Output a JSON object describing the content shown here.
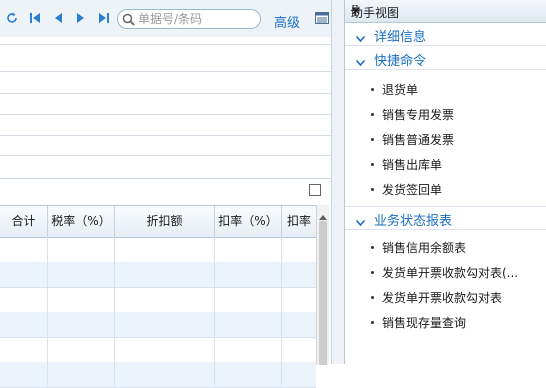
{
  "toolbar": {
    "search_placeholder": "单据号/条码",
    "advanced_label": "高级"
  },
  "grid": {
    "columns": [
      "合计",
      "税率（%）",
      "折扣额",
      "扣率（%）",
      "扣率"
    ],
    "row_count": 6
  },
  "assistant_panel": {
    "title": "助手视图",
    "sections": [
      {
        "label": "详细信息",
        "items": []
      },
      {
        "label": "快捷命令",
        "items": [
          "退货单",
          "销售专用发票",
          "销售普通发票",
          "销售出库单",
          "发货签回单"
        ]
      },
      {
        "label": "业务状态报表",
        "items": [
          "销售信用余额表",
          "发货单开票收款勾对表(...",
          "发货单开票收款勾对表",
          "销售现存量查询"
        ]
      }
    ]
  },
  "colors": {
    "accent": "#1a6fc4",
    "toolbar_bg": "#eef3f8",
    "alt_row": "#edf3fa"
  }
}
